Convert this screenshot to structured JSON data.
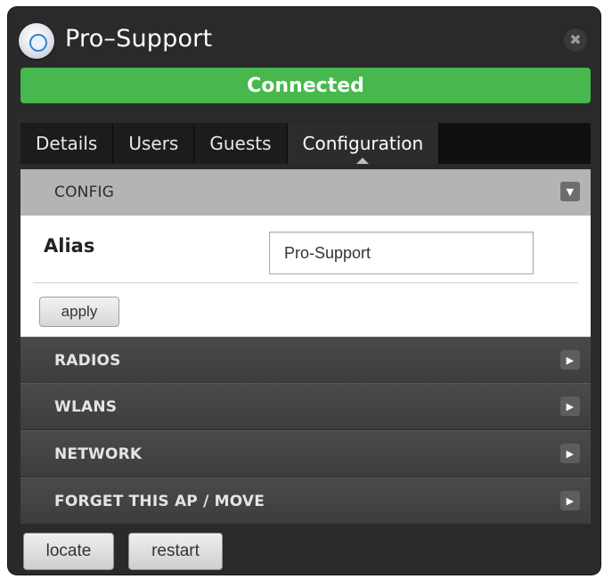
{
  "header": {
    "title": "Pro–Support",
    "close_symbol": "✖"
  },
  "status": {
    "text": "Connected",
    "color": "#47b84e"
  },
  "tabs": [
    {
      "label": "Details",
      "active": false
    },
    {
      "label": "Users",
      "active": false
    },
    {
      "label": "Guests",
      "active": false
    },
    {
      "label": "Configuration",
      "active": true
    }
  ],
  "config": {
    "section_label": "CONFIG",
    "alias_label": "Alias",
    "alias_value": "Pro-Support",
    "apply_label": "apply"
  },
  "sections": [
    {
      "label": "RADIOS"
    },
    {
      "label": "WLANS"
    },
    {
      "label": "NETWORK"
    },
    {
      "label": "FORGET THIS AP / MOVE"
    }
  ],
  "buttons": {
    "locate": "locate",
    "restart": "restart"
  },
  "icons": {
    "ap": "access-point-icon",
    "close": "close-icon",
    "expand": "triangle-right-icon",
    "collapse": "triangle-down-icon"
  }
}
